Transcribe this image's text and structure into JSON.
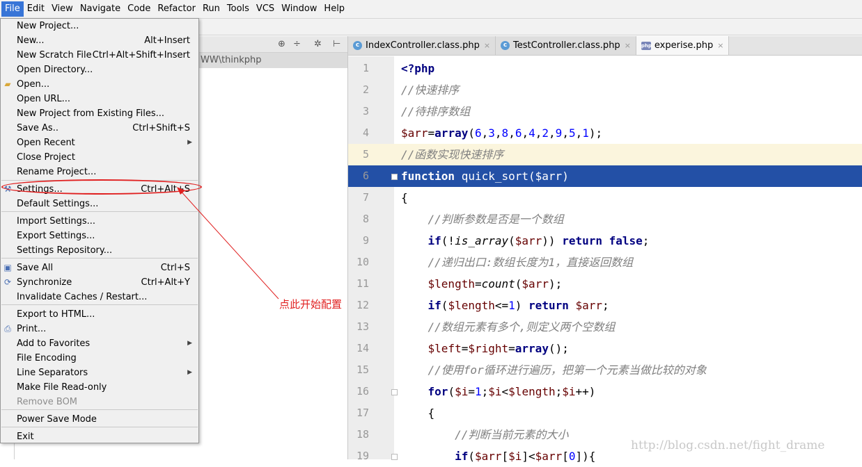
{
  "menubar": {
    "items": [
      "File",
      "Edit",
      "View",
      "Navigate",
      "Code",
      "Refactor",
      "Run",
      "Tools",
      "VCS",
      "Window",
      "Help"
    ],
    "active": "File"
  },
  "project_panel": {
    "path": "WW\\thinkphp"
  },
  "tabs": [
    {
      "label": "IndexController.class.php",
      "icon": "c-class-icon",
      "active": false
    },
    {
      "label": "TestController.class.php",
      "icon": "c-class-icon",
      "active": false
    },
    {
      "label": "experise.php",
      "icon": "php-file-icon",
      "active": true
    }
  ],
  "file_menu": {
    "items": [
      {
        "label": "New Project...",
        "shortcut": ""
      },
      {
        "label": "New...",
        "shortcut": "Alt+Insert"
      },
      {
        "label": "New Scratch File",
        "shortcut": "Ctrl+Alt+Shift+Insert"
      },
      {
        "label": "Open Directory...",
        "shortcut": ""
      },
      {
        "label": "Open...",
        "shortcut": "",
        "icon": "folder-icon"
      },
      {
        "label": "Open URL...",
        "shortcut": ""
      },
      {
        "label": "New Project from Existing Files...",
        "shortcut": ""
      },
      {
        "label": "Save As..",
        "shortcut": "Ctrl+Shift+S"
      },
      {
        "label": "Open Recent",
        "shortcut": "",
        "submenu": true
      },
      {
        "label": "Close Project",
        "shortcut": ""
      },
      {
        "label": "Rename Project...",
        "shortcut": ""
      },
      {
        "label": "Settings...",
        "shortcut": "Ctrl+Alt+S",
        "icon": "wrench-icon"
      },
      {
        "label": "Default Settings...",
        "shortcut": ""
      },
      {
        "label": "Import Settings...",
        "shortcut": ""
      },
      {
        "label": "Export Settings...",
        "shortcut": ""
      },
      {
        "label": "Settings Repository...",
        "shortcut": ""
      },
      {
        "label": "Save All",
        "shortcut": "Ctrl+S",
        "icon": "save-icon"
      },
      {
        "label": "Synchronize",
        "shortcut": "Ctrl+Alt+Y",
        "icon": "sync-icon"
      },
      {
        "label": "Invalidate Caches / Restart...",
        "shortcut": ""
      },
      {
        "label": "Export to HTML...",
        "shortcut": ""
      },
      {
        "label": "Print...",
        "shortcut": "",
        "icon": "print-icon"
      },
      {
        "label": "Add to Favorites",
        "shortcut": "",
        "submenu": true
      },
      {
        "label": "File Encoding",
        "shortcut": ""
      },
      {
        "label": "Line Separators",
        "shortcut": "",
        "submenu": true
      },
      {
        "label": "Make File Read-only",
        "shortcut": ""
      },
      {
        "label": "Remove BOM",
        "shortcut": "",
        "disabled": true
      },
      {
        "label": "Power Save Mode",
        "shortcut": ""
      },
      {
        "label": "Exit",
        "shortcut": ""
      }
    ]
  },
  "editor": {
    "lines": [
      {
        "n": "1",
        "html": "<span class=\"kw\">&lt;?php</span>"
      },
      {
        "n": "2",
        "html": "<span class=\"cm\">//快速排序</span>"
      },
      {
        "n": "3",
        "html": "<span class=\"cm\">//待排序数组</span>"
      },
      {
        "n": "4",
        "html": "<span class=\"var\">$arr</span>=<span class=\"kw\">array</span>(<span class=\"num\">6</span>,<span class=\"num\">3</span>,<span class=\"num\">8</span>,<span class=\"num\">6</span>,<span class=\"num\">4</span>,<span class=\"num\">2</span>,<span class=\"num\">9</span>,<span class=\"num\">5</span>,<span class=\"num\">1</span>);"
      },
      {
        "n": "5",
        "html": "<span class=\"cm\">//函数实现快速排序</span>",
        "caret": true
      },
      {
        "n": "6",
        "html": "<span class=\"kw\">function</span> quick_sort($arr)",
        "selected": true
      },
      {
        "n": "7",
        "html": "{"
      },
      {
        "n": "8",
        "html": "    <span class=\"cm\">//判断参数是否是一个数组</span>"
      },
      {
        "n": "9",
        "html": "    <span class=\"kw\">if</span>(!<span class=\"fn\">is_array</span>(<span class=\"var\">$arr</span>)) <span class=\"kw\">return false</span>;"
      },
      {
        "n": "10",
        "html": "    <span class=\"cm\">//递归出口:数组长度为1，直接返回数组</span>"
      },
      {
        "n": "11",
        "html": "    <span class=\"var\">$length</span>=<span class=\"fn\">count</span>(<span class=\"var\">$arr</span>);"
      },
      {
        "n": "12",
        "html": "    <span class=\"kw\">if</span>(<span class=\"var\">$length</span>&lt;=<span class=\"num\">1</span>) <span class=\"kw\">return</span> <span class=\"var\">$arr</span>;"
      },
      {
        "n": "13",
        "html": "    <span class=\"cm\">//数组元素有多个,则定义两个空数组</span>"
      },
      {
        "n": "14",
        "html": "    <span class=\"var\">$left</span>=<span class=\"var\">$right</span>=<span class=\"kw\">array</span>();"
      },
      {
        "n": "15",
        "html": "    <span class=\"cm\">//使用for循环进行遍历，把第一个元素当做比较的对象</span>"
      },
      {
        "n": "16",
        "html": "    <span class=\"kw\">for</span>(<span class=\"var\">$i</span>=<span class=\"num\">1</span>;<span class=\"var\">$i</span>&lt;<span class=\"var\">$length</span>;<span class=\"var\">$i</span>++)"
      },
      {
        "n": "17",
        "html": "    {"
      },
      {
        "n": "18",
        "html": "        <span class=\"cm\">//判断当前元素的大小</span>"
      },
      {
        "n": "19",
        "html": "        <span class=\"kw\">if</span>(<span class=\"var\">$arr</span>[<span class=\"var\">$i</span>]&lt;<span class=\"var\">$arr</span>[<span class=\"num\">0</span>]){"
      }
    ]
  },
  "annotation": {
    "text": "点此开始配置",
    "color": "#e02020"
  },
  "watermark": "http://blog.csdn.net/fight_drame",
  "colors": {
    "selection": "#2350a6",
    "caret_line": "#fbf5dd",
    "menu_active": "#3875d7"
  }
}
